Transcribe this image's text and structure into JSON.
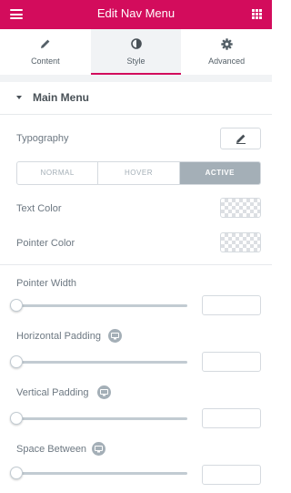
{
  "header": {
    "title": "Edit Nav Menu",
    "left_icon": "hamburger-menu-icon",
    "right_icon": "widgets-grid-icon",
    "background": "#d30c5c"
  },
  "tabs": [
    {
      "label": "Content",
      "icon": "pencil-icon",
      "active": false
    },
    {
      "label": "Style",
      "icon": "half-circle-icon",
      "active": true
    },
    {
      "label": "Advanced",
      "icon": "gear-icon",
      "active": false
    }
  ],
  "section": {
    "title": "Main Menu",
    "expanded": true
  },
  "typography": {
    "label": "Typography",
    "button_icon": "pencil-icon"
  },
  "state_switcher": {
    "options": [
      "NORMAL",
      "HOVER",
      "ACTIVE"
    ],
    "selected": "ACTIVE"
  },
  "text_color": {
    "label": "Text Color",
    "value": ""
  },
  "pointer_color": {
    "label": "Pointer Color",
    "value": ""
  },
  "pointer_width": {
    "label": "Pointer Width",
    "value": "",
    "slider_fraction": 0
  },
  "horizontal_padding": {
    "label": "Horizontal Padding",
    "value": "",
    "slider_fraction": 0,
    "responsive_icon": "desktop-icon"
  },
  "vertical_padding": {
    "label": "Vertical Padding",
    "value": "",
    "slider_fraction": 0,
    "responsive_icon": "desktop-icon"
  },
  "space_between": {
    "label": "Space Between",
    "value": "",
    "slider_fraction": 0,
    "responsive_icon": "desktop-icon"
  },
  "colors": {
    "accent": "#d30c5c",
    "active_option_bg": "#a4afb7",
    "panel_bg": "#f1f3f5"
  }
}
